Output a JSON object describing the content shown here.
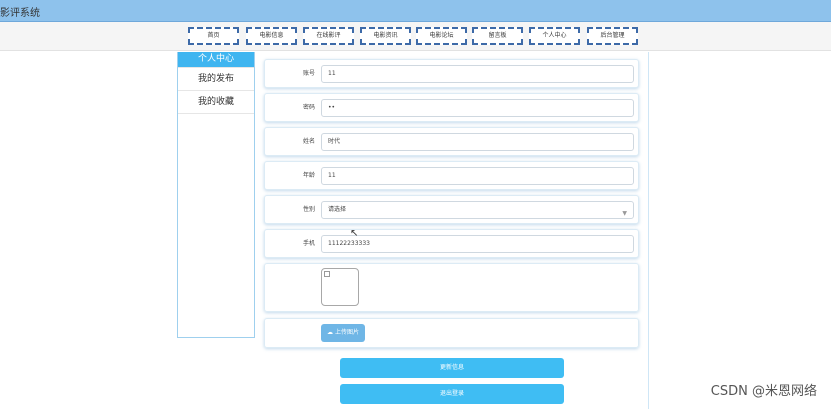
{
  "app": {
    "title": "影评系统"
  },
  "nav": {
    "items": [
      "首页",
      "电影信息",
      "在线影评",
      "电影资讯",
      "电影论坛",
      "留言板",
      "个人中心",
      "后台管理"
    ]
  },
  "sidebar": {
    "items": [
      {
        "label": "个人中心",
        "active": true
      },
      {
        "label": "我的发布",
        "active": false
      },
      {
        "label": "我的收藏",
        "active": false
      }
    ]
  },
  "form": {
    "account_label": "账号",
    "account_value": "11",
    "password_label": "密码",
    "password_value": "••",
    "name_label": "姓名",
    "name_value": "时代",
    "age_label": "年龄",
    "age_value": "11",
    "gender_label": "性别",
    "gender_value": "请选择",
    "phone_label": "手机",
    "phone_value": "11122233333",
    "upload_label": "上传图片"
  },
  "actions": {
    "update_label": "更新信息",
    "logout_label": "退出登录"
  },
  "watermark": "CSDN @米恩网络",
  "colors": {
    "accent": "#3fbdf3",
    "topbar": "#8ec2ec",
    "nav_border": "#3d6aa8"
  }
}
